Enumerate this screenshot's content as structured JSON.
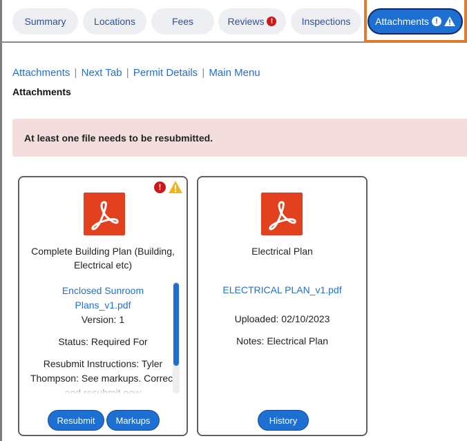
{
  "tabs": [
    {
      "label": "Summary"
    },
    {
      "label": "Locations"
    },
    {
      "label": "Fees"
    },
    {
      "label": "Reviews",
      "badge": "!"
    },
    {
      "label": "Inspections"
    },
    {
      "label": "Attachments",
      "badge": "!"
    }
  ],
  "nav_links": [
    "Attachments",
    "Next Tab",
    "Permit Details",
    "Main Menu"
  ],
  "nav_separator": "|",
  "section_title": "Attachments",
  "alert": {
    "message": "At least one file needs to be resubmitted."
  },
  "cards": [
    {
      "title": "Complete Building Plan (Building, Electrical etc)",
      "badges": {
        "error": "!",
        "warning": "!"
      },
      "file_link": "Enclosed Sunroom Plans_v1.pdf",
      "version": "Version: 1",
      "status": "Status: Required For",
      "resubmit_instructions": "Resubmit Instructions: Tyler Thompson: See markups. Correct and resubmit now",
      "buttons": {
        "resubmit": "Resubmit",
        "markups": "Markups"
      }
    },
    {
      "title": "Electrical Plan",
      "file_link": "ELECTRICAL PLAN_v1.pdf",
      "uploaded": "Uploaded: 02/10/2023",
      "notes": "Notes: Electrical Plan",
      "buttons": {
        "history": "History"
      }
    }
  ],
  "colors": {
    "accent": "#1e6fd2",
    "link": "#1f6fd0",
    "alert_bg": "#f3dddd",
    "error": "#d01717",
    "warning": "#f2b31b",
    "pdf": "#e2411f",
    "highlight": "#e07b2d"
  },
  "icons": [
    "error-icon",
    "warning-icon",
    "pdf-icon"
  ]
}
